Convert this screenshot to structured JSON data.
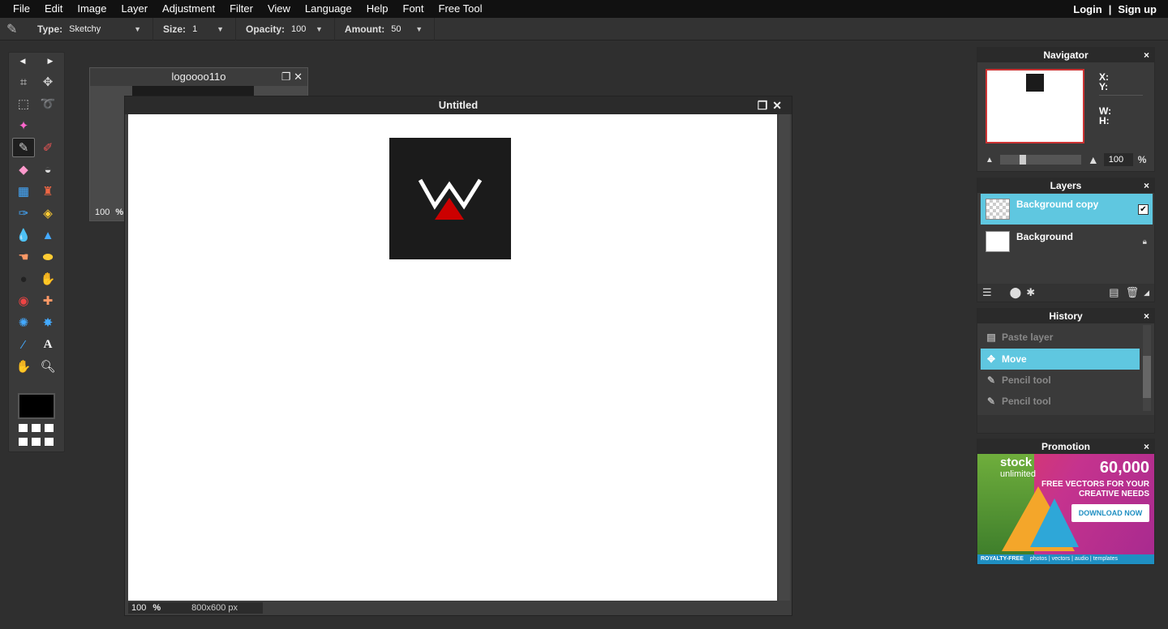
{
  "menu": {
    "items": [
      "File",
      "Edit",
      "Image",
      "Layer",
      "Adjustment",
      "Filter",
      "View",
      "Language",
      "Help",
      "Font",
      "Free Tool"
    ],
    "login": "Login",
    "separator": "|",
    "signup": "Sign up"
  },
  "options": {
    "type_label": "Type:",
    "type_value": "Sketchy",
    "size_label": "Size:",
    "size_value": "1",
    "opacity_label": "Opacity:",
    "opacity_value": "100",
    "amount_label": "Amount:",
    "amount_value": "50"
  },
  "colors": {
    "accent": "#5fc7e0",
    "menubar": "#111111",
    "workspace": "#2f2f2f",
    "logo_red": "#cc0000"
  },
  "doc_back": {
    "title": "logoooo11o",
    "zoom": "100",
    "pct": "%"
  },
  "doc_main": {
    "title": "Untitled",
    "zoom": "100",
    "pct": "%",
    "dimensions": "800x600 px"
  },
  "navigator": {
    "title": "Navigator",
    "close": "×",
    "x_label": "X:",
    "y_label": "Y:",
    "w_label": "W:",
    "h_label": "H:",
    "zoom": "100",
    "pct": "%"
  },
  "layers": {
    "title": "Layers",
    "close": "×",
    "items": [
      {
        "name": "Background copy",
        "selected": true
      },
      {
        "name": "Background",
        "selected": false
      }
    ]
  },
  "history": {
    "title": "History",
    "close": "×",
    "items": [
      {
        "name": "Paste layer",
        "icon": "paste-icon"
      },
      {
        "name": "Move",
        "icon": "move-icon"
      },
      {
        "name": "Pencil tool",
        "icon": "pencil-icon"
      },
      {
        "name": "Pencil tool",
        "icon": "pencil-icon"
      }
    ]
  },
  "promo": {
    "title": "Promotion",
    "close": "×",
    "brand": "stock",
    "brand_sub": "unlimited",
    "headline": "60,000",
    "subline": "FREE VECTORS FOR YOUR CREATIVE NEEDS",
    "cta": "DOWNLOAD NOW",
    "footer_lead": "ROYALTY-FREE",
    "footer_rest": "photos | vectors | audio | templates"
  }
}
